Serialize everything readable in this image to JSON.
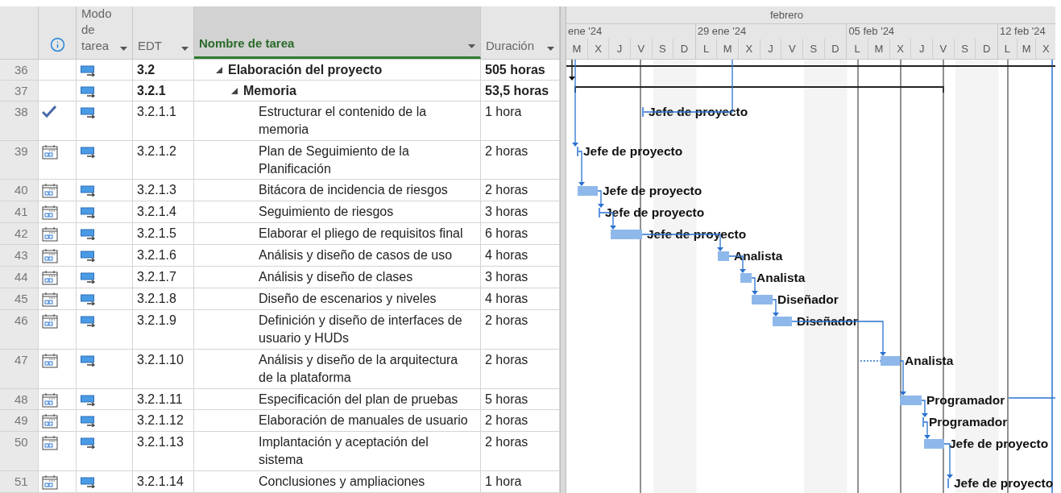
{
  "columns": [
    {
      "kind": "row_number"
    },
    {
      "kind": "indicator"
    },
    {
      "kind": "mode",
      "label": "Modo de tarea",
      "selected": false
    },
    {
      "kind": "wbs",
      "label": "EDT",
      "selected": false
    },
    {
      "kind": "name",
      "label": "Nombre de tarea",
      "selected": true
    },
    {
      "kind": "duration",
      "label": "Duración",
      "selected": false
    }
  ],
  "timescale": {
    "month": "febrero",
    "weeks": [
      {
        "label": "ene '24",
        "days": [
          "M",
          "X",
          "J",
          "V",
          "S",
          "D"
        ]
      },
      {
        "label": "29 ene '24",
        "days": [
          "L",
          "M",
          "X",
          "J",
          "V",
          "S",
          "D"
        ]
      },
      {
        "label": "05 feb '24",
        "days": [
          "L",
          "M",
          "X",
          "J",
          "V",
          "S",
          "D"
        ]
      },
      {
        "label": "12 feb '24",
        "days": [
          "L",
          "M",
          "X"
        ]
      }
    ]
  },
  "tasks": [
    {
      "id": "36",
      "auto_scheduled": true,
      "wbs": "3.2",
      "name": "Elaboración del proyecto",
      "duration": "505 horas",
      "expanded": true,
      "children": [
        {
          "id": "37",
          "auto_scheduled": true,
          "wbs": "3.2.1",
          "name": "Memoria",
          "duration": "53,5 horas",
          "expanded": true,
          "children": [
            {
              "id": "38",
              "completed": true,
              "calendar": false,
              "auto_scheduled": true,
              "wbs": "3.2.1.1",
              "name": "Estructurar el contenido de la memoria",
              "duration": "1 hora",
              "resource": "Jefe de proyecto"
            },
            {
              "id": "39",
              "completed": false,
              "calendar": true,
              "auto_scheduled": true,
              "wbs": "3.2.1.2",
              "name": "Plan de Seguimiento de la Planificación",
              "duration": "2 horas",
              "resource": "Jefe de proyecto"
            },
            {
              "id": "40",
              "completed": false,
              "calendar": true,
              "auto_scheduled": true,
              "wbs": "3.2.1.3",
              "name": "Bitácora de incidencia de riesgos",
              "duration": "2 horas",
              "resource": "Jefe de proyecto"
            },
            {
              "id": "41",
              "completed": false,
              "calendar": true,
              "auto_scheduled": true,
              "wbs": "3.2.1.4",
              "name": "Seguimiento de riesgos",
              "duration": "3 horas",
              "resource": "Jefe de proyecto"
            },
            {
              "id": "42",
              "completed": false,
              "calendar": true,
              "auto_scheduled": true,
              "wbs": "3.2.1.5",
              "name": "Elaborar el pliego de requisitos final",
              "duration": "6 horas",
              "resource": "Jefe de proyecto"
            },
            {
              "id": "43",
              "completed": false,
              "calendar": true,
              "auto_scheduled": true,
              "wbs": "3.2.1.6",
              "name": "Análisis y diseño de casos de uso",
              "duration": "4 horas",
              "resource": "Analista"
            },
            {
              "id": "44",
              "completed": false,
              "calendar": true,
              "auto_scheduled": true,
              "wbs": "3.2.1.7",
              "name": "Análisis y diseño de clases",
              "duration": "3 horas",
              "resource": "Analista"
            },
            {
              "id": "45",
              "completed": false,
              "calendar": true,
              "auto_scheduled": true,
              "wbs": "3.2.1.8",
              "name": "Diseño de escenarios y niveles",
              "duration": "4 horas",
              "resource": "Diseñador"
            },
            {
              "id": "46",
              "completed": false,
              "calendar": true,
              "auto_scheduled": true,
              "wbs": "3.2.1.9",
              "name": "Definición y diseño de interfaces de usuario y HUDs",
              "duration": "2 horas",
              "resource": "Diseñador"
            },
            {
              "id": "47",
              "completed": false,
              "calendar": true,
              "auto_scheduled": true,
              "wbs": "3.2.1.10",
              "name": "Análisis y diseño de la arquitectura de la plataforma",
              "duration": "2 horas",
              "resource": "Analista"
            },
            {
              "id": "48",
              "completed": false,
              "calendar": true,
              "auto_scheduled": true,
              "wbs": "3.2.1.11",
              "name": "Especificación del plan de pruebas",
              "duration": "5 horas",
              "resource": "Programador"
            },
            {
              "id": "49",
              "completed": false,
              "calendar": true,
              "auto_scheduled": true,
              "wbs": "3.2.1.12",
              "name": "Elaboración de manuales de usuario",
              "duration": "2 horas",
              "resource": "Programador"
            },
            {
              "id": "50",
              "completed": false,
              "calendar": true,
              "auto_scheduled": true,
              "wbs": "3.2.1.13",
              "name": "Implantación y aceptación del sistema",
              "duration": "2 horas",
              "resource": "Jefe de proyecto"
            },
            {
              "id": "51",
              "completed": false,
              "calendar": true,
              "auto_scheduled": true,
              "wbs": "3.2.1.14",
              "name": "Conclusiones y ampliaciones",
              "duration": "1 hora",
              "resource": "Jefe de proyecto"
            }
          ]
        }
      ]
    }
  ]
}
